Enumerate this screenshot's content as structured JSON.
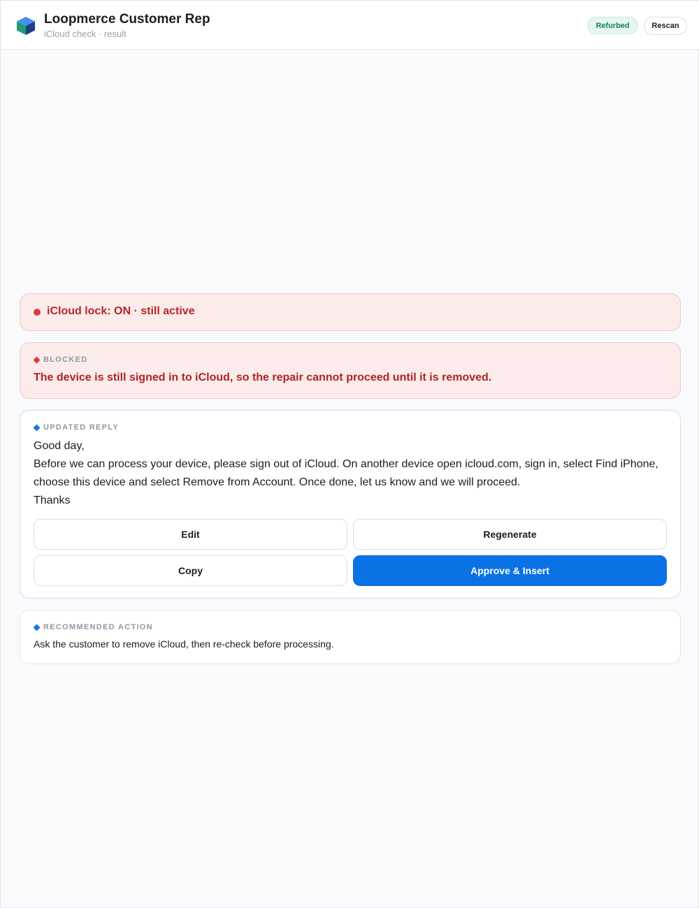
{
  "header": {
    "title": "Loopmerce Customer Rep",
    "subtitle": "iCloud check · result",
    "badge": "Refurbed",
    "rescan_label": "Rescan",
    "logo_icon": "cube-icon"
  },
  "status": {
    "lock_text": "iCloud lock: ON · still active",
    "color": "#dc3b3b"
  },
  "blocked": {
    "label": "BLOCKED",
    "message": "The device is still signed in to iCloud, so the repair cannot proceed until it is removed."
  },
  "reply": {
    "label": "UPDATED REPLY",
    "greeting": "Good day,",
    "body": "Before we can process your device, please sign out of iCloud. On another device open icloud.com, sign in, select Find iPhone, choose this device and select Remove from Account. Once done, let us know and we will proceed.",
    "signoff": "Thanks",
    "buttons": {
      "edit": "Edit",
      "regenerate": "Regenerate",
      "copy": "Copy",
      "approve": "Approve & Insert"
    },
    "accent": "#0b72e5"
  },
  "recommended": {
    "label": "RECOMMENDED ACTION",
    "text": "Ask the customer to remove iCloud, then re-check before processing."
  }
}
